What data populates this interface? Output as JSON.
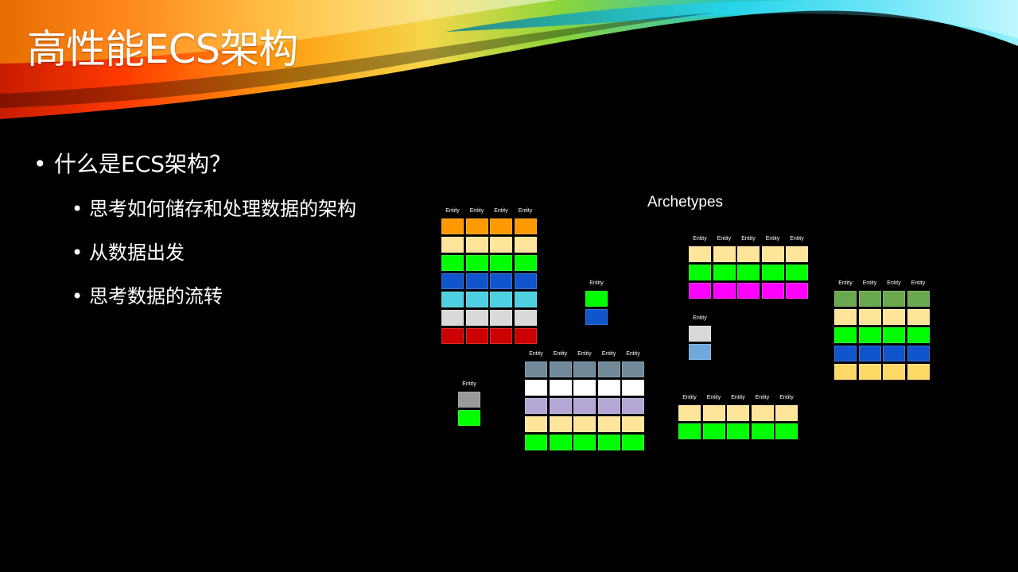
{
  "slide": {
    "title": "高性能ECS架构",
    "bullets": [
      {
        "level": 1,
        "text": "什么是ECS架构？"
      },
      {
        "level": 2,
        "text": "思考如何储存和处理数据的架构"
      },
      {
        "level": 2,
        "text": "从数据出发"
      },
      {
        "level": 2,
        "text": "思考数据的流转"
      }
    ],
    "bullet_char": "•"
  },
  "diagram": {
    "label": "Archetypes",
    "entity_label": "Entity",
    "archetypes": [
      {
        "entities": 4,
        "rows": [
          "#FF9900",
          "#FFE599",
          "#00FF00",
          "#1155CC",
          "#4DD0E1",
          "#D9D9D9",
          "#CC0000"
        ]
      },
      {
        "entities": 1,
        "rows": [
          "#00FF00",
          "#1155CC"
        ]
      },
      {
        "entities": 5,
        "rows": [
          "#FFE599",
          "#00FF00",
          "#FF00FF"
        ]
      },
      {
        "entities": 4,
        "rows": [
          "#6AA84F",
          "#FFE599",
          "#00FF00",
          "#1155CC",
          "#FFD966"
        ]
      },
      {
        "entities": 1,
        "rows": [
          "#D9D9D9",
          "#6FA8DC"
        ]
      },
      {
        "entities": 5,
        "rows": [
          "#718A99",
          "#FFFFFF",
          "#B4A7D6",
          "#FFE599",
          "#00FF00"
        ]
      },
      {
        "entities": 1,
        "rows": [
          "#999999",
          "#00FF00"
        ]
      },
      {
        "entities": 5,
        "rows": [
          "#FFE599",
          "#00FF00"
        ]
      }
    ]
  }
}
